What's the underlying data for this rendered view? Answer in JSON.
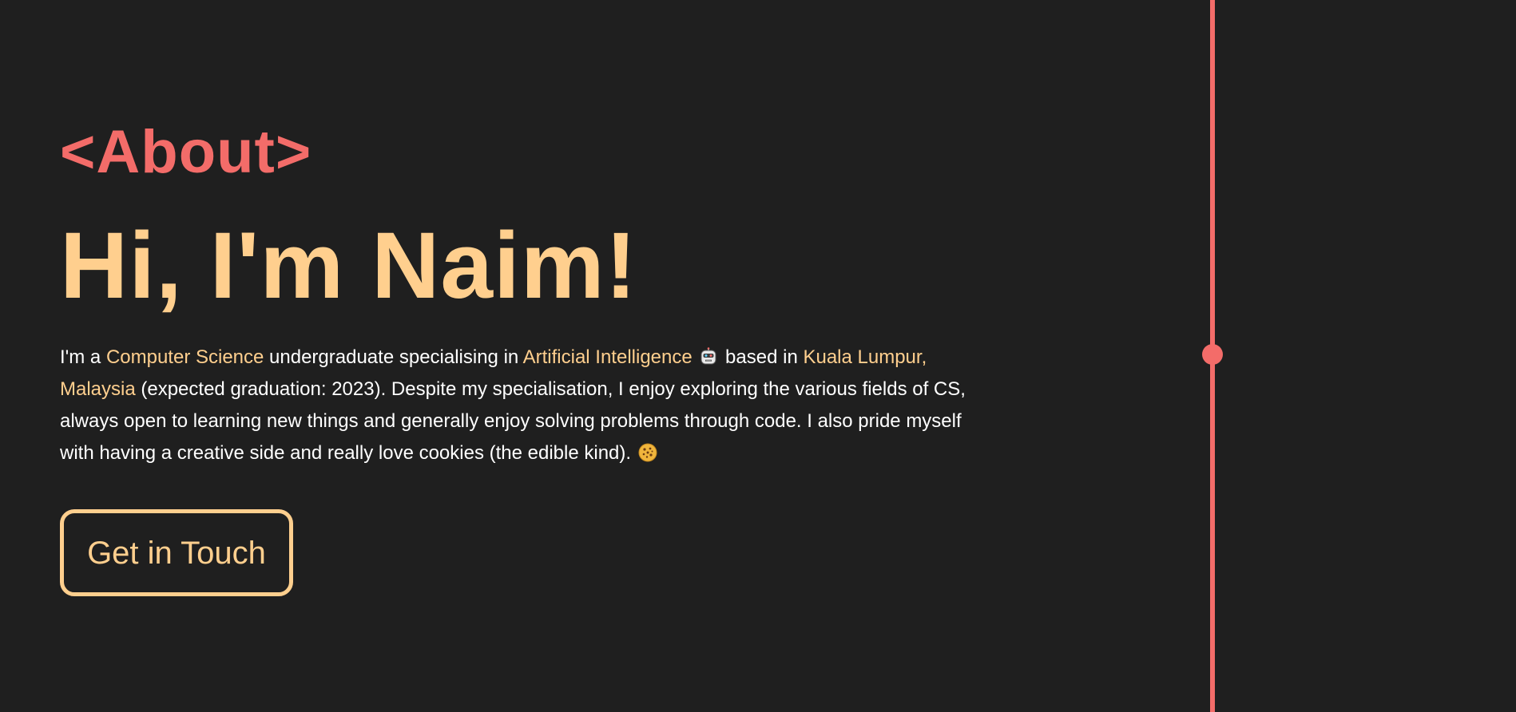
{
  "section": {
    "tag": "<About>"
  },
  "hero": {
    "greeting": "Hi, I'm Naim!"
  },
  "bio": {
    "intro": "I'm a ",
    "field": "Computer Science",
    "mid1": " undergraduate specialising in ",
    "specialisation": "Artificial Intelligence",
    "specialisation_icon": "robot-face-icon",
    "mid2": " based in ",
    "location": "Kuala Lumpur, Malaysia",
    "rest": " (expected graduation: 2023). Despite my specialisation, I enjoy exploring the various fields of CS, always open to learning new things and generally enjoy solving problems through code. I also pride myself with having a creative side and really love cookies (the edible kind). ",
    "end_icon": "cookie-icon"
  },
  "cta": {
    "label": "Get in Touch"
  },
  "colors": {
    "background": "#1f1f1f",
    "accent_red": "#f36c69",
    "accent_peach": "#ffcf8e",
    "text": "#ffffff"
  },
  "timeline": {
    "icon": "timeline-dot"
  }
}
